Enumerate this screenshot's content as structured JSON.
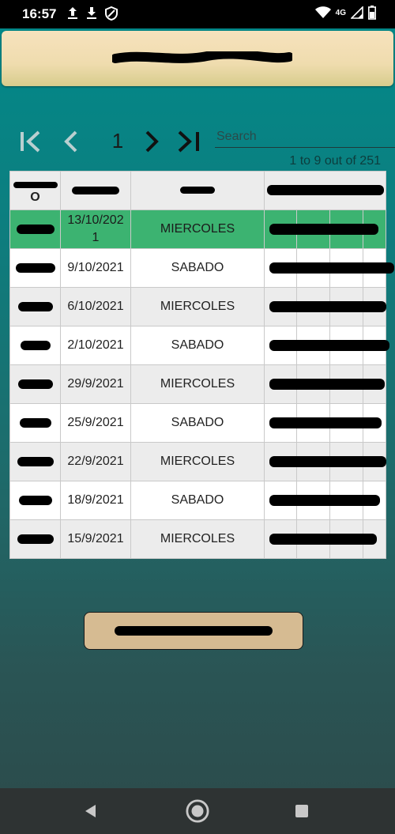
{
  "status_bar": {
    "time": "16:57",
    "left_icons": [
      "upload-icon",
      "download-icon",
      "data-saver-icon"
    ],
    "network": "4G",
    "right_icons": [
      "wifi-icon",
      "signal-icon",
      "battery-icon"
    ]
  },
  "pager": {
    "current_page": "1",
    "search_placeholder": "Search",
    "count_text": "1 to 9 out of 251"
  },
  "table": {
    "header_suffix": "O",
    "rows": [
      {
        "fecha": "13/10/202\n1",
        "dia": "MIERCOLES",
        "selected": true
      },
      {
        "fecha": "9/10/2021",
        "dia": "SABADO",
        "selected": false
      },
      {
        "fecha": "6/10/2021",
        "dia": "MIERCOLES",
        "selected": false
      },
      {
        "fecha": "2/10/2021",
        "dia": "SABADO",
        "selected": false
      },
      {
        "fecha": "29/9/2021",
        "dia": "MIERCOLES",
        "selected": false
      },
      {
        "fecha": "25/9/2021",
        "dia": "SABADO",
        "selected": false
      },
      {
        "fecha": "22/9/2021",
        "dia": "MIERCOLES",
        "selected": false
      },
      {
        "fecha": "18/9/2021",
        "dia": "SABADO",
        "selected": false
      },
      {
        "fecha": "15/9/2021",
        "dia": "MIERCOLES",
        "selected": false
      }
    ]
  },
  "colors": {
    "selected_row": "#3cb371",
    "header_bg_top": "#f7e2bd",
    "button_bg": "#d6bb92",
    "background_top": "#008a8a"
  }
}
